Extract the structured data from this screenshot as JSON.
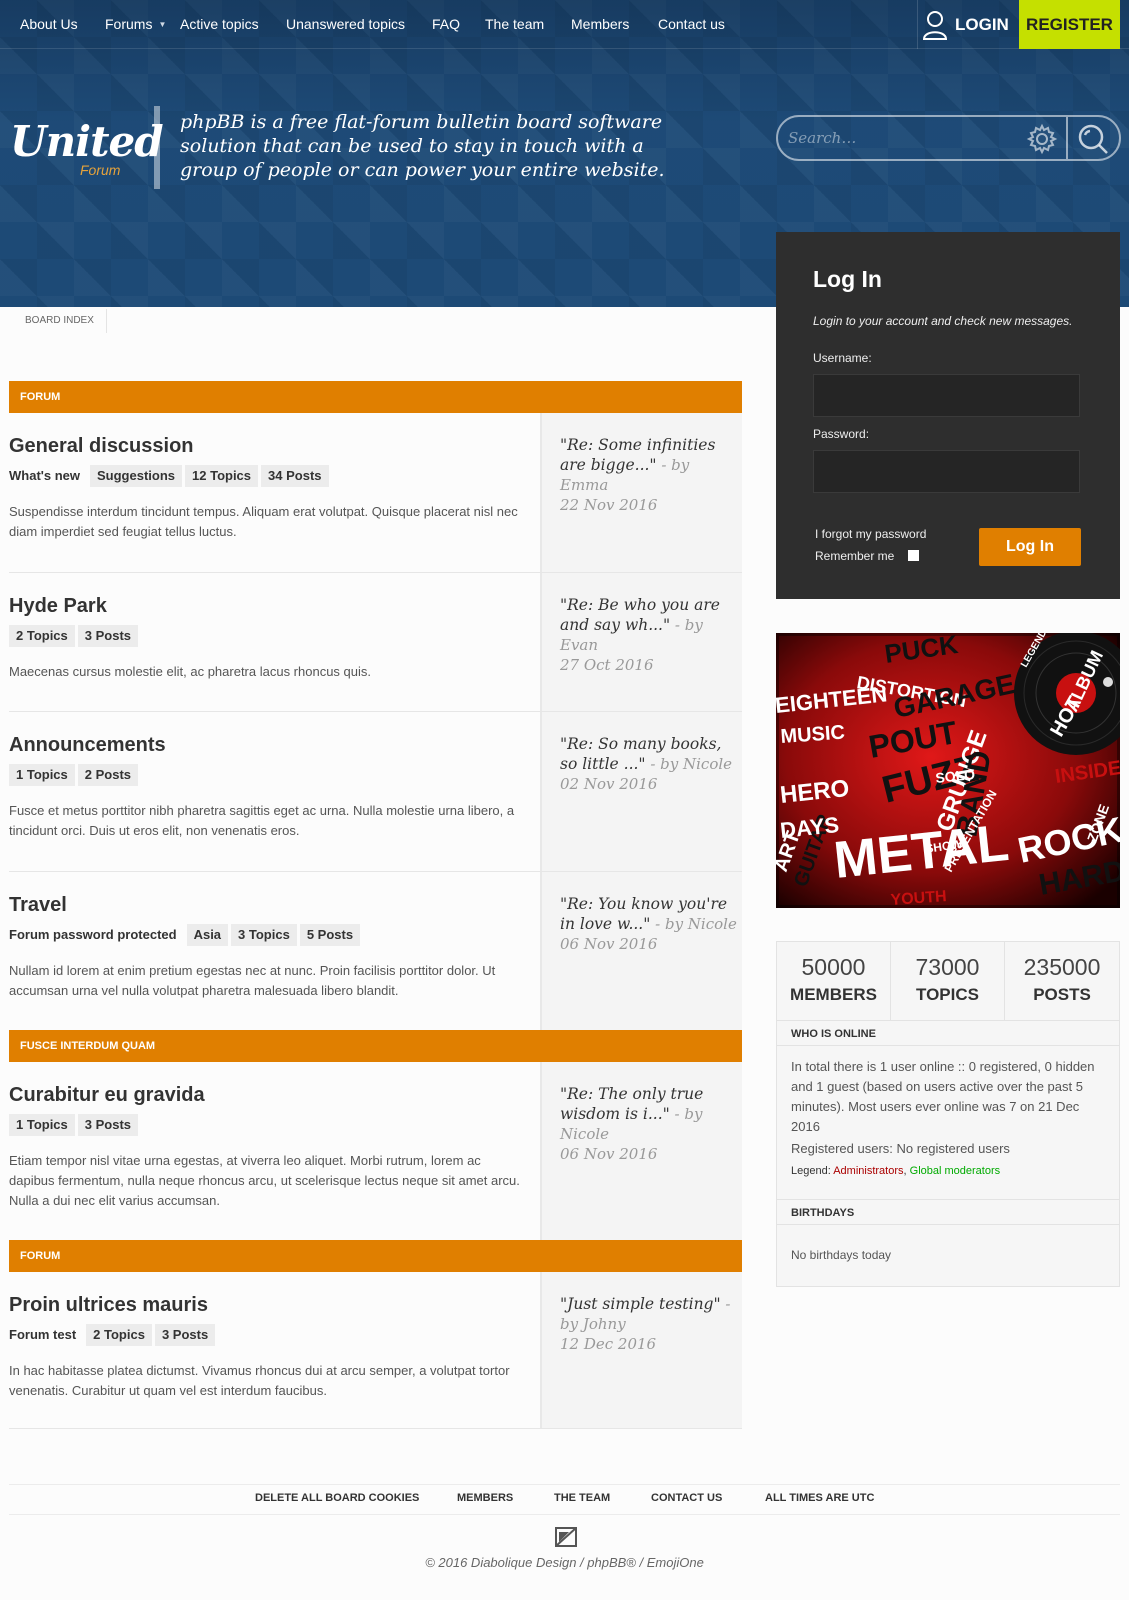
{
  "nav": {
    "about": "About Us",
    "forums": "Forums",
    "active": "Active topics",
    "unanswered": "Unanswered topics",
    "faq": "FAQ",
    "team": "The team",
    "members": "Members",
    "contact": "Contact us",
    "login": "LOGIN",
    "register": "REGISTER"
  },
  "brand": {
    "logo_main": "United",
    "logo_sub": "Forum",
    "tagline": "phpBB is a free flat-forum bulletin board software solution that can be used to stay in touch with a group of people or can power your entire website."
  },
  "search": {
    "placeholder": "Search…"
  },
  "breadcrumb": "BOARD INDEX",
  "categories": [
    {
      "label": "FORUM"
    },
    {
      "label": "FUSCE INTERDUM QUAM"
    },
    {
      "label": "FORUM"
    }
  ],
  "forums": [
    {
      "title": "General discussion",
      "tags": [
        "What's new",
        "Suggestions",
        "12 Topics",
        "34 Posts"
      ],
      "desc": "Suspendisse interdum tincidunt tempus. Aliquam erat volutpat. Quisque placerat nisl nec diam imperdiet sed feugiat tellus luctus.",
      "last_title": "\"Re: Some infinities are bigge...\"",
      "last_by": " - by Emma",
      "last_date": "22 Nov 2016"
    },
    {
      "title": "Hyde Park",
      "tags": [
        "2 Topics",
        "3 Posts"
      ],
      "desc": "Maecenas cursus molestie elit, ac pharetra lacus rhoncus quis.",
      "last_title": "\"Re: Be who you are and say wh...\"",
      "last_by": " - by Evan",
      "last_date": "27 Oct 2016"
    },
    {
      "title": "Announcements",
      "tags": [
        "1 Topics",
        "2 Posts"
      ],
      "desc": "Fusce et metus porttitor nibh pharetra sagittis eget ac urna. Nulla molestie urna libero, a tincidunt orci. Duis ut eros elit, non venenatis eros.",
      "last_title": "\"Re: So many books, so little ...\"",
      "last_by": " - by Nicole",
      "last_date": "02 Nov 2016"
    },
    {
      "title": "Travel",
      "tags": [
        "Forum password protected",
        "Asia",
        "3 Topics",
        "5 Posts"
      ],
      "desc": "Nullam id lorem at enim pretium egestas nec at nunc. Proin facilisis porttitor dolor. Ut accumsan urna vel nulla volutpat pharetra malesuada libero blandit.",
      "last_title": "\"Re: You know you're in love w...\"",
      "last_by": " - by Nicole",
      "last_date": "06 Nov 2016"
    },
    {
      "title": "Curabitur eu gravida",
      "tags": [
        "1 Topics",
        "3 Posts"
      ],
      "desc": "Etiam tempor nisl vitae urna egestas, at viverra leo aliquet. Morbi rutrum, lorem ac dapibus fermentum, nulla neque rhoncus arcu, ut scelerisque lectus neque sit amet arcu. Nulla a dui nec elit varius accumsan.",
      "last_title": "\"Re: The only true wisdom is i...\"",
      "last_by": " - by Nicole",
      "last_date": "06 Nov 2016"
    },
    {
      "title": "Proin ultrices mauris",
      "tags": [
        "Forum test",
        "2 Topics",
        "3 Posts"
      ],
      "desc": "In hac habitasse platea dictumst. Vivamus rhoncus dui at arcu semper, a volutpat tortor venenatis. Curabitur ut quam vel est interdum faucibus.",
      "last_title": "\"Just simple testing\"",
      "last_by": " - by Johny",
      "last_date": "12 Dec 2016"
    }
  ],
  "login": {
    "title": "Log In",
    "subtitle": "Login to your account and check new messages.",
    "username_label": "Username:",
    "password_label": "Password:",
    "forgot": "I forgot my password",
    "remember": "Remember me",
    "submit": "Log In"
  },
  "promo_words": [
    "PUCK",
    "DISTORTION",
    "EIGHTEEN",
    "GARAGE",
    "MUSIC",
    "POUT",
    "FUZZ",
    "GRUNGE",
    "BAND",
    "ROCK",
    "METAL",
    "HARD",
    "INSIDE",
    "ZONE",
    "HOT",
    "ALBUM",
    "ART",
    "GUITAR",
    "YOUTH",
    "DAYS",
    "HERO",
    "SHOW",
    "PRESENTATION",
    "SOLO",
    "LEGENDARY"
  ],
  "stats": [
    {
      "num": "50000",
      "label": "MEMBERS"
    },
    {
      "num": "73000",
      "label": "TOPICS"
    },
    {
      "num": "235000",
      "label": "POSTS"
    }
  ],
  "online": {
    "head": "WHO IS ONLINE",
    "text": "In total there is 1 user online :: 0 registered, 0 hidden and 1 guest (based on users active over the past 5 minutes). Most users ever online was 7 on 21 Dec 2016",
    "registered": "Registered users: No registered users",
    "legend_label": "Legend: ",
    "legend_admin": "Administrators",
    "legend_sep": ", ",
    "legend_mod": "Global moderators"
  },
  "birthdays": {
    "head": "BIRTHDAYS",
    "text": "No birthdays today"
  },
  "footer": {
    "cookies": "DELETE ALL BOARD COOKIES",
    "members": "MEMBERS",
    "team": "THE TEAM",
    "contact": "CONTACT US",
    "times": "ALL TIMES ARE UTC",
    "copyright": "© 2016 Diabolique Design / phpBB® / EmojiOne"
  },
  "colors": {
    "header": "#1e4b78",
    "accent": "#e07f00",
    "register": "#c5e000",
    "login_panel": "#2e2e2e"
  }
}
